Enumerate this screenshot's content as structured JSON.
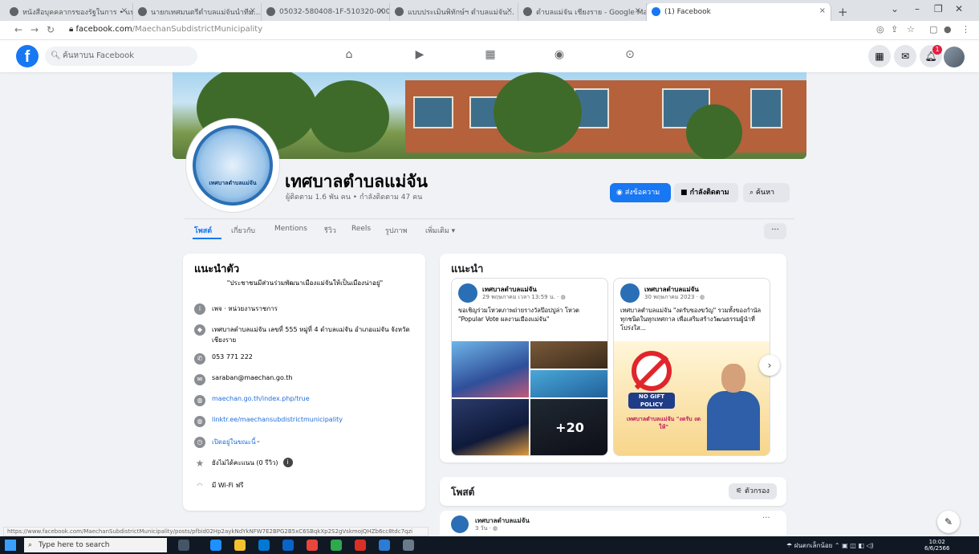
{
  "browser": {
    "tabs": [
      {
        "label": "หนังสือบุคคลากรของรัฐในการ • แบบ..."
      },
      {
        "label": "นายกเทศมนตรีตำบลแม่จันนำทีม..."
      },
      {
        "label": "05032-580408-1F-510320-0000..."
      },
      {
        "label": "แบบประเมินพิทักษ์ฯ ตำบลแม่จัน..."
      },
      {
        "label": "ตำบลแม่จัน เชียงราย - Google Ma..."
      },
      {
        "label": "(1) Facebook"
      }
    ],
    "new_tab": "+",
    "url_host": "facebook.com",
    "url_path": "/MaechanSubdistrictMunicipality"
  },
  "fb_header": {
    "logo": "f",
    "search_placeholder": "ค้นหาบน Facebook",
    "notification_count": "1"
  },
  "page": {
    "name": "เทศบาลตำบลแม่จัน",
    "subtitle": "ผู้ติดตาม 1.6 พัน คน • กำลังติดตาม 47 คน",
    "seal_text": "เทศบาลตำบลแม่จัน",
    "message_button": "ส่งข้อความ",
    "follow_button": "กำลังติดตาม",
    "search_button": "ค้นหา",
    "tabs": [
      "โพสต์",
      "เกี่ยวกับ",
      "Mentions",
      "รีวิว",
      "Reels",
      "รูปภาพ",
      "เพิ่มเติม ▾"
    ],
    "more_button": "···"
  },
  "intro": {
    "title": "แนะนำตัว",
    "bio": "\"ประชาชนมีส่วนร่วมพัฒนาเมืองแม่จันให้เป็นเมืองน่าอยู่\"",
    "category": "เพจ · หน่วยงานราชการ",
    "address": "เทศบาลตำบลแม่จัน เลขที่ 555 หมู่ที่ 4 ตำบลแม่จัน อำเภอแม่จัน จังหวัดเชียงราย",
    "phone": "053 771 222",
    "email": "saraban@maechan.go.th",
    "website": "maechan.go.th/index.php/true",
    "linktree": "linktr.ee/maechansubdistrictmunicipality",
    "hours": "เปิดอยู่ในขณะนี้",
    "rating": "ยังไม่ได้คะแนน (0 รีวิว)",
    "wifi": "มี Wi-Fi ฟรี"
  },
  "featured": {
    "title": "แนะนำ",
    "cards": [
      {
        "author": "เทศบาลตำบลแม่จัน",
        "date": "29 พฤษภาคม เวลา 13:59 น. · ",
        "text": "ขอเชิญร่วมโหวตภาพถ่ายรางวัลป๊อปปูล่า โหวต \"Popular Vote ผลงานเมืองแม่จัน\"",
        "more_photos": "+20"
      },
      {
        "author": "เทศบาลตำบลแม่จัน",
        "date": "30 พฤษภาคม 2023 · ",
        "text": "เทศบาลตำบลแม่จัน \"งดรับของขวัญ\" รวมทั้งของกำนัลทุกชนิดในทุกเทศกาล เพื่อเสริมสร้างวัฒนธรรมผู้นำที่โปร่งใส...",
        "policy_line1": "NO GIFT",
        "policy_line2": "POLICY",
        "poster_title": "เทศบาลตำบลแม่จัน \"งดรับ งดให้\""
      }
    ]
  },
  "posts": {
    "title": "โพสต์",
    "filter_button": "ตัวกรอง",
    "first_post_author": "เทศบาลตำบลแม่จัน",
    "first_post_time": "3 วัน · ",
    "dots": "···"
  },
  "status_url": "https://www.facebook.com/MaechanSubdistrictMunicipality/posts/pfbid02Hp2aykNdYkNFW7E2BPG2B5xC6SBqkXp2S2gVskmojQHZb6cc8tdc7qzi",
  "taskbar": {
    "search_placeholder": "Type here to search",
    "tray_text": "ฝนตกเล็กน้อย",
    "clock_time": "10:02",
    "clock_date": "6/6/2566"
  }
}
